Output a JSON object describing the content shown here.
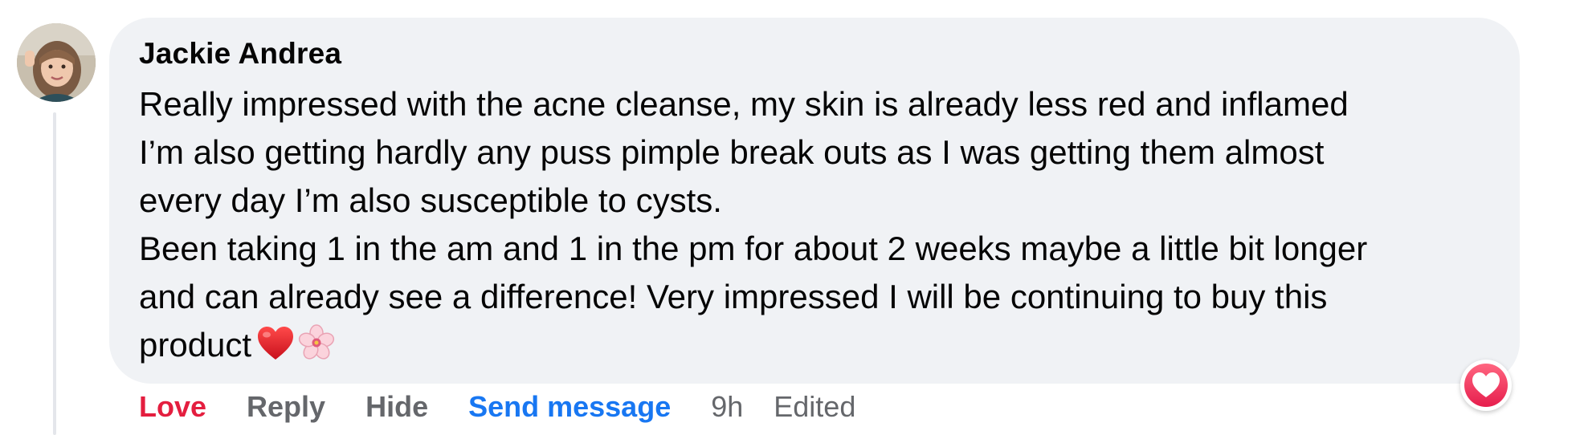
{
  "comment": {
    "author": "Jackie Andrea",
    "lines": [
      "Really impressed with the acne cleanse, my skin is already less red and inflamed",
      "I’m also getting hardly any puss pimple break outs as I was getting them almost",
      "every day I’m also susceptible to cysts.",
      "Been taking 1 in the am and 1 in the pm for about 2 weeks maybe a little bit longer",
      "and can already see a difference! Very impressed I will be continuing to buy this",
      "product"
    ],
    "emojis": [
      "red-heart-emoji",
      "cherry-blossom-emoji"
    ]
  },
  "actions": {
    "love": "Love",
    "reply": "Reply",
    "hide": "Hide",
    "send_message": "Send message",
    "timestamp": "9h",
    "edited": "Edited"
  },
  "reaction": {
    "type": "love",
    "icon": "heart-icon"
  },
  "colors": {
    "bubble": "#f0f2f5",
    "love": "#e41e3f",
    "link": "#1877f2",
    "muted": "#65676b",
    "text": "#050505"
  }
}
